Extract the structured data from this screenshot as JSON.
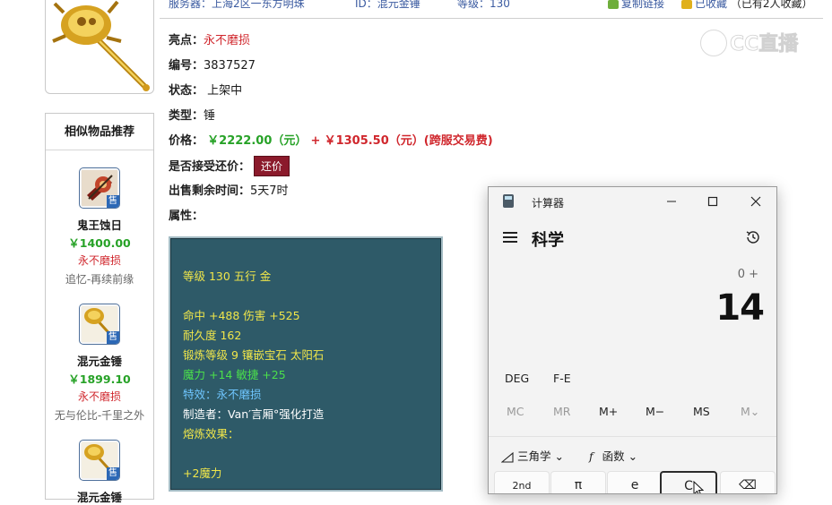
{
  "top": {
    "server": "服务器：上海2区一东方明珠",
    "id": "ID：混元金锤",
    "level": "等级：130",
    "copy_link": "复制链接",
    "collected": "已收藏",
    "collected_count": "（已有2人收藏）"
  },
  "watermark": "CC直播",
  "item": {
    "highlight_label": "亮点：",
    "highlight_value": "永不磨损",
    "number_label": "编号：",
    "number_value": "3837527",
    "status_label": "状态：",
    "status_value": "上架中",
    "type_label": "类型：",
    "type_value": "锤",
    "price_label": "价格：",
    "price_value": "￥2222.00（元）",
    "price_plus": "+",
    "price_extra": "￥1305.50（元）(跨服交易费)",
    "bargain_label": "是否接受还价：",
    "bargain_button": "还价",
    "remaining_label": "出售剩余时间：",
    "remaining_value": "5天7时",
    "attributes_label": "属性："
  },
  "attributes": {
    "line1": "等级 130 五行 金",
    "line2": "命中 +488 伤害 +525",
    "line3": "耐久度 162",
    "line4": "锻炼等级 9 镶嵌宝石 太阳石",
    "line5": "魔力 +14 敏捷 +25",
    "line6": "特效：永不磨损",
    "line7": "制造者：Van′言厢°强化打造",
    "line8": "熔炼效果：",
    "line9": "+2魔力"
  },
  "similar": {
    "title": "相似物品推荐",
    "sale_badge": "售",
    "items": [
      {
        "name": "鬼王蚀日",
        "price": "￥1400.00",
        "tag": "永不磨损",
        "server": "追忆-再续前缘"
      },
      {
        "name": "混元金锤",
        "price": "￥1899.10",
        "tag": "永不磨损",
        "server": "无与伦比-千里之外"
      },
      {
        "name": "混元金锤"
      }
    ]
  },
  "calculator": {
    "window_title": "计算器",
    "mode": "科学",
    "expression": "0 +",
    "display": "14",
    "deg": "DEG",
    "fe": "F-E",
    "mem": [
      "MC",
      "MR",
      "M+",
      "M−",
      "MS",
      "M⌄"
    ],
    "trig": "三角学",
    "func": "函数",
    "keys": [
      "2nd",
      "π",
      "e",
      "C",
      "⌫"
    ]
  },
  "colors": {
    "price_red": "#d0272d",
    "price_green": "#27a227",
    "bargain_bg": "#8b1a2b",
    "attr_bg": "#2e5a68"
  }
}
